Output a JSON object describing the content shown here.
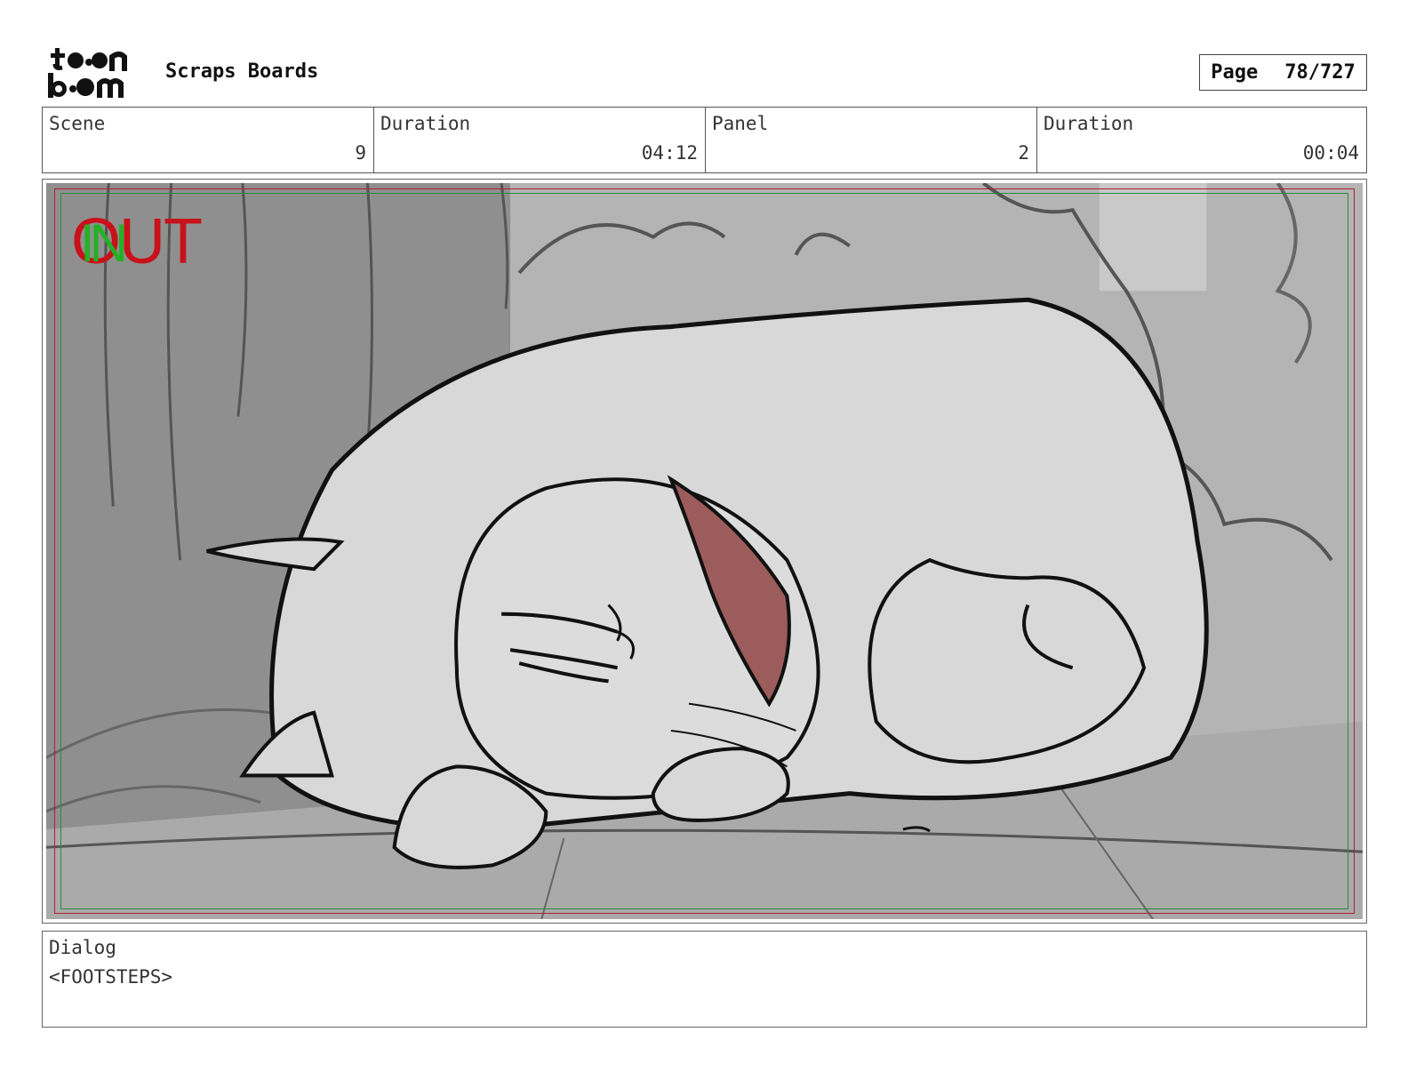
{
  "header": {
    "logo_text": "toonboom",
    "project_title": "Scraps Boards",
    "page_label": "Page",
    "page_value": "78/727"
  },
  "info": {
    "scene_label": "Scene",
    "scene_value": "9",
    "scene_duration_label": "Duration",
    "scene_duration_value": "04:12",
    "panel_label": "Panel",
    "panel_value": "2",
    "panel_duration_label": "Duration",
    "panel_duration_value": "00:04"
  },
  "panel": {
    "marker_out": "OUT",
    "marker_in": "IN",
    "accent_red": "#c8111a",
    "accent_green": "#22b222",
    "ear_color": "#9c5c5c"
  },
  "dialog": {
    "label": "Dialog",
    "text": "<FOOTSTEPS>"
  }
}
